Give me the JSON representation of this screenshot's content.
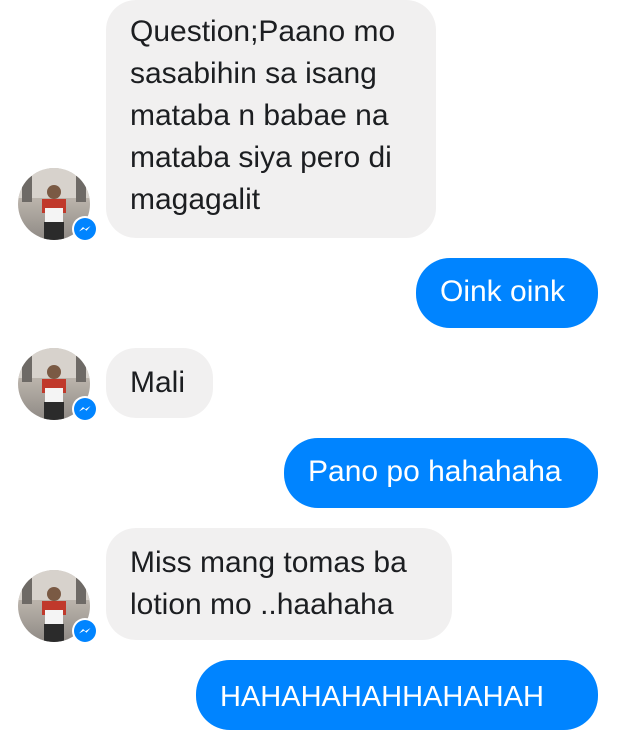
{
  "colors": {
    "incoming_bubble": "#f1f0f0",
    "incoming_text": "#1c1e21",
    "outgoing_bubble": "#0084ff",
    "outgoing_text": "#ffffff",
    "messenger_badge": "#0084ff"
  },
  "icons": {
    "avatar": "contact-avatar-photo",
    "badge": "messenger-icon"
  },
  "messages": [
    {
      "direction": "incoming",
      "text": "Question;Paano mo\nsasabihin sa isang\nmataba n babae na\nmataba siya pero di\nmagagalit"
    },
    {
      "direction": "outgoing",
      "text": "Oink oink"
    },
    {
      "direction": "incoming",
      "text": "Mali"
    },
    {
      "direction": "outgoing",
      "text": "Pano po hahahaha"
    },
    {
      "direction": "incoming",
      "text": "Miss mang tomas ba\nlotion mo ..haahaha"
    },
    {
      "direction": "outgoing",
      "text": "HAHAHAHAHHAHAHAH"
    }
  ]
}
